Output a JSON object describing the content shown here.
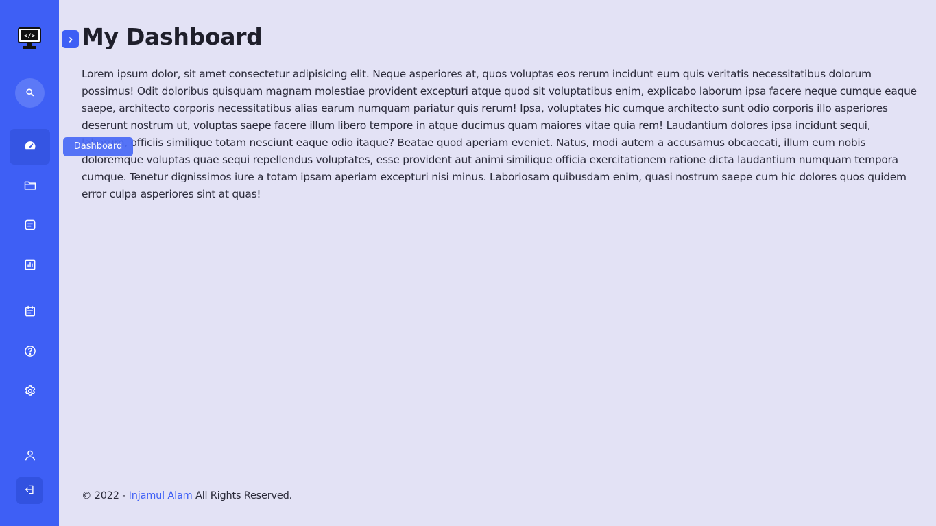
{
  "sidebar": {
    "logo_icon": "monitor-code-icon",
    "search_icon": "search-icon",
    "items": [
      {
        "key": "dashboard",
        "label": "Dashboard",
        "icon": "speedometer-icon",
        "active": true
      },
      {
        "key": "folder",
        "label": "",
        "icon": "folder-icon"
      },
      {
        "key": "notes",
        "label": "",
        "icon": "note-icon"
      },
      {
        "key": "analytics",
        "label": "",
        "icon": "bar-chart-icon"
      },
      {
        "key": "calendar",
        "label": "",
        "icon": "calendar-icon"
      },
      {
        "key": "help",
        "label": "",
        "icon": "help-circle-icon"
      },
      {
        "key": "settings",
        "label": "",
        "icon": "gear-icon"
      },
      {
        "key": "profile",
        "label": "",
        "icon": "user-icon"
      }
    ],
    "logout_icon": "logout-icon"
  },
  "toggle": {
    "icon": "chevron-right-icon"
  },
  "tooltip": {
    "label": "Dashboard"
  },
  "main": {
    "title": "My Dashboard",
    "body": "Lorem ipsum dolor, sit amet consectetur adipisicing elit. Neque asperiores at, quos voluptas eos rerum incidunt eum quis veritatis necessitatibus dolorum possimus! Odit doloribus quisquam magnam molestiae provident excepturi atque quod sit voluptatibus enim, explicabo laborum ipsa facere neque cumque eaque saepe, architecto corporis necessitatibus alias earum numquam pariatur quis rerum! Ipsa, voluptates hic cumque architecto sunt odio corporis illo asperiores deserunt nostrum ut, voluptas saepe facere illum libero tempore in atque ducimus quam maiores vitae quia rem! Laudantium dolores ipsa incidunt sequi, laborum, officiis similique totam nesciunt eaque odio itaque? Beatae quod aperiam eveniet. Natus, modi autem a accusamus obcaecati, illum eum nobis doloremque voluptas quae sequi repellendus voluptates, esse provident aut animi similique officia exercitationem ratione dicta laudantium numquam tempora cumque. Tenetur dignissimos iure a totam ipsam aperiam excepturi nisi minus. Laboriosam quibusdam enim, quasi nostrum saepe cum hic dolores quos quidem error culpa asperiores sint at quas!"
  },
  "footer": {
    "prefix": "© 2022 - ",
    "author": "Injamul Alam",
    "suffix": " All Rights Reserved."
  },
  "colors": {
    "sidebar": "#3e5ff5",
    "background": "#e3e2f5",
    "accent": "#3e5ff5"
  }
}
